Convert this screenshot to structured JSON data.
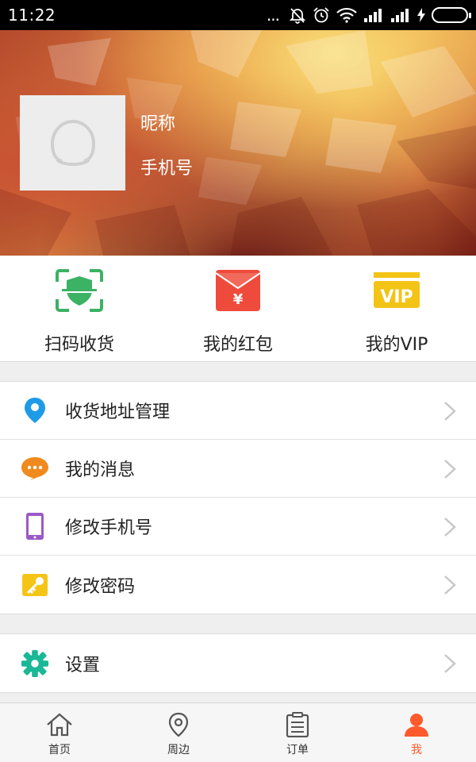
{
  "status_bar": {
    "time": "11:22",
    "overflow": "...",
    "battery_color": "#3ed43c"
  },
  "profile": {
    "nickname": "昵称",
    "phone": "手机号"
  },
  "quick_actions": [
    {
      "label": "扫码收货",
      "icon": "scan-shield-icon",
      "color": "#3bb264"
    },
    {
      "label": "我的红包",
      "icon": "red-envelope-icon",
      "color": "#ef4b3c"
    },
    {
      "label": "我的VIP",
      "icon": "vip-badge-icon",
      "color": "#f3c316"
    }
  ],
  "menu": {
    "group1": [
      {
        "label": "收货地址管理",
        "icon": "location-pin-icon",
        "color": "#1e9be6"
      },
      {
        "label": "我的消息",
        "icon": "chat-bubble-icon",
        "color": "#f08a1e"
      },
      {
        "label": "修改手机号",
        "icon": "mobile-phone-icon",
        "color": "#9b59c7"
      },
      {
        "label": "修改密码",
        "icon": "key-icon",
        "color": "#f5c516"
      }
    ],
    "group2": [
      {
        "label": "设置",
        "icon": "settings-gear-icon",
        "color": "#1ab896"
      }
    ]
  },
  "tabbar": [
    {
      "label": "首页",
      "icon": "home-icon"
    },
    {
      "label": "周边",
      "icon": "map-pin-icon"
    },
    {
      "label": "订单",
      "icon": "order-list-icon"
    },
    {
      "label": "我",
      "icon": "user-icon",
      "active": true
    }
  ],
  "colors": {
    "accent": "#ff5a2c"
  }
}
